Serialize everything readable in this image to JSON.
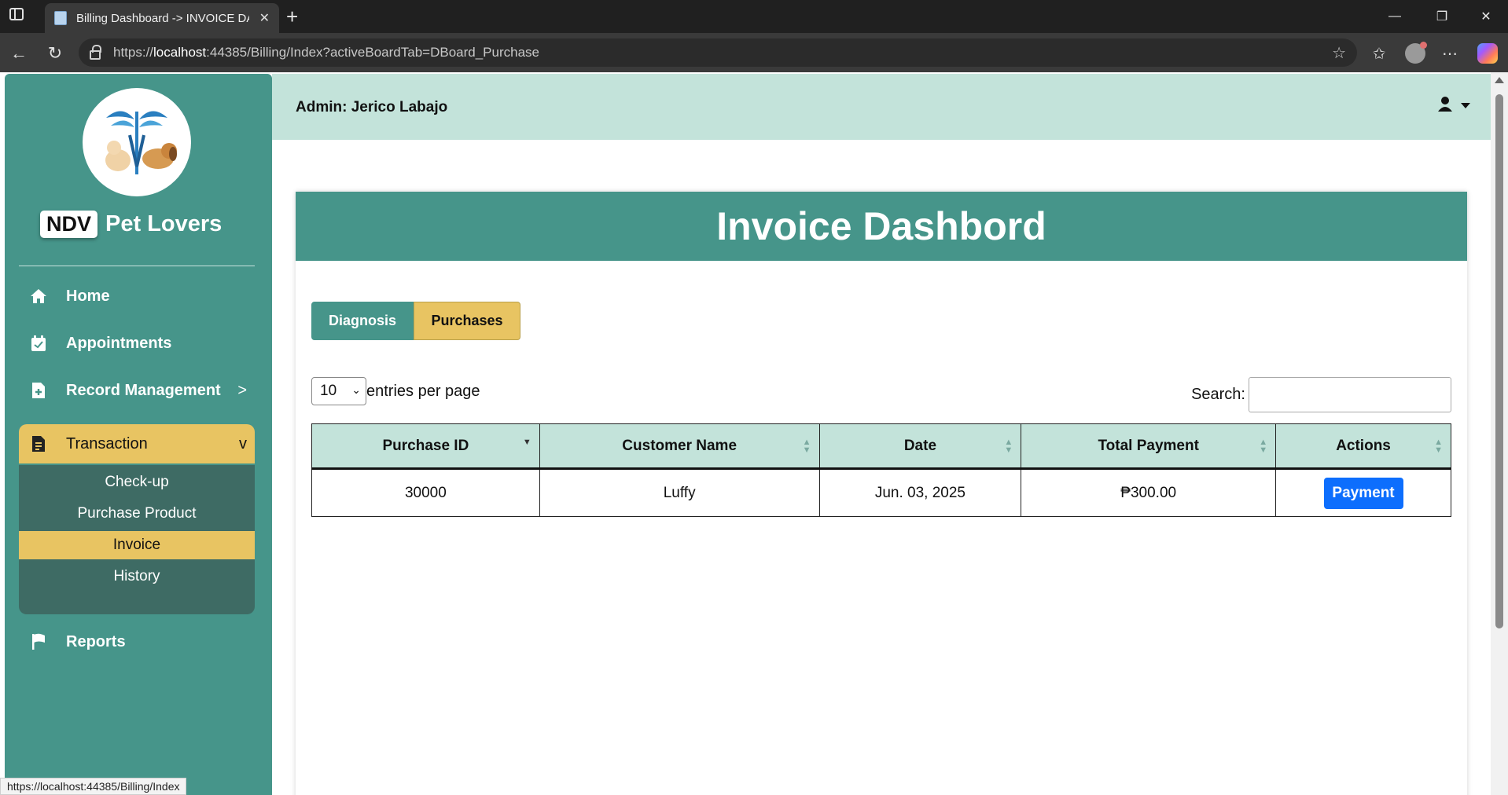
{
  "browser": {
    "tab_title": "Billing Dashboard -> INVOICE DA",
    "url_prefix": "https://",
    "url_host": "localhost",
    "url_rest": ":44385/Billing/Index?activeBoardTab=DBoard_Purchase",
    "status_url": "https://localhost:44385/Billing/Index"
  },
  "sidebar": {
    "brand_badge": "NDV",
    "brand_name": "Pet Lovers",
    "items": [
      {
        "label": "Home",
        "icon": "home-icon"
      },
      {
        "label": "Appointments",
        "icon": "calendar-check-icon"
      },
      {
        "label": "Record Management",
        "icon": "file-plus-icon",
        "chevron": ">"
      },
      {
        "label": "Transaction",
        "icon": "receipt-icon",
        "chevron": "v"
      },
      {
        "label": "Reports",
        "icon": "flag-icon"
      }
    ],
    "submenu": [
      "Check-up",
      "Purchase Product",
      "Invoice",
      "History"
    ]
  },
  "header": {
    "admin": "Admin: Jerico Labajo"
  },
  "main": {
    "title": "Invoice Dashbord",
    "tabs": [
      "Diagnosis",
      "Purchases"
    ],
    "page_length": "10",
    "page_length_label": "entries per page",
    "search_label": "Search:",
    "search_value": "",
    "columns": [
      "Purchase ID",
      "Customer Name",
      "Date",
      "Total Payment",
      "Actions"
    ],
    "rows": [
      {
        "purchase_id": "30000",
        "customer": "Luffy",
        "date": "Jun. 03, 2025",
        "total": "₱300.00",
        "action": "Payment"
      }
    ]
  },
  "colors": {
    "primary_teal": "#46958a",
    "accent_yellow": "#e8c462",
    "header_mint": "#c3e3da",
    "submenu_dark": "#3e6b64",
    "payment_blue": "#0d6efd"
  }
}
